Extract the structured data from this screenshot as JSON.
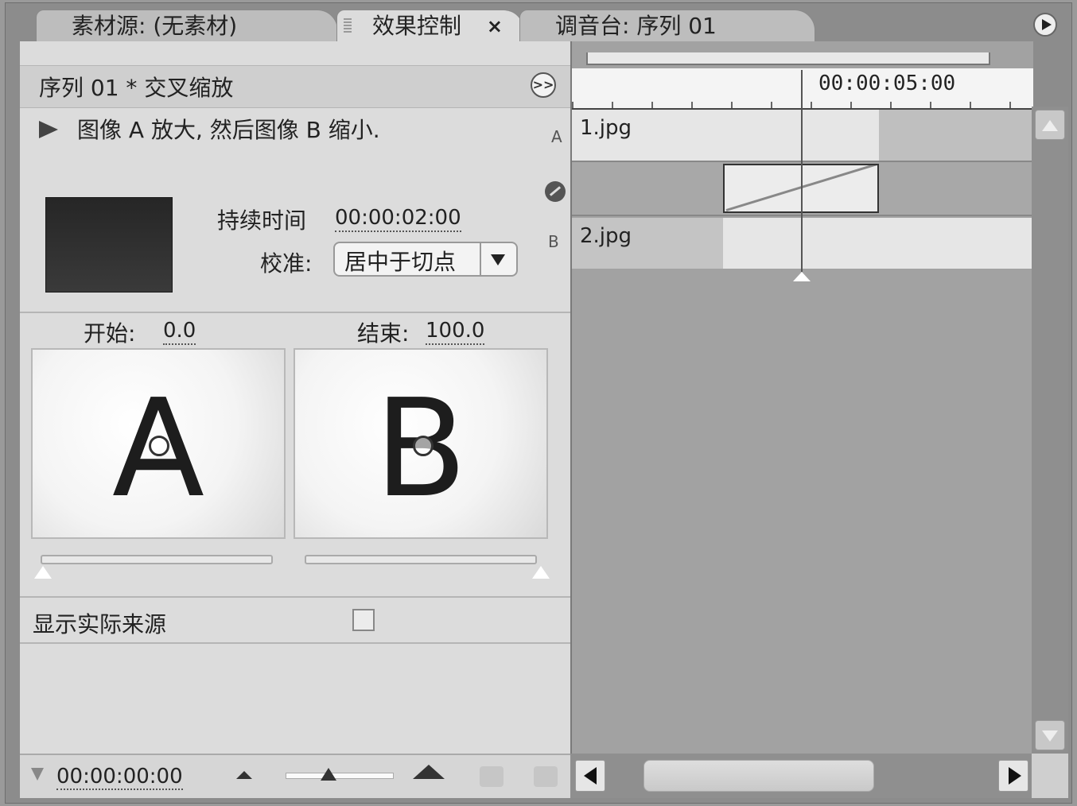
{
  "tabs": [
    {
      "label": "素材源: (无素材)"
    },
    {
      "label": "效果控制",
      "close": "×"
    },
    {
      "label": "调音台: 序列 01"
    }
  ],
  "effect": {
    "header_title": "序列 01 * 交叉缩放",
    "description": "图像 A 放大, 然后图像 B 缩小.",
    "duration_label": "持续时间",
    "duration_value": "00:00:02:00",
    "align_label": "校准:",
    "align_value": "居中于切点",
    "side_a": "A",
    "side_b": "B",
    "start_label": "开始:",
    "start_value": "0.0",
    "end_label": "结束:",
    "end_value": "100.0",
    "thumb_a": "A",
    "thumb_b": "B",
    "show_actual_sources_label": "显示实际来源",
    "show_actual_sources_checked": false
  },
  "timeline": {
    "ruler_time": "00:00:05:00",
    "clip_a": "1.jpg",
    "clip_b": "2.jpg"
  },
  "bottom": {
    "current_time": "00:00:00:00"
  }
}
